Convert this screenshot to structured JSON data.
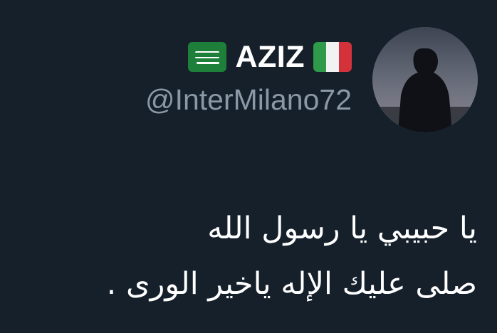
{
  "author": {
    "display_name": "AZIZ",
    "handle": "@InterMilano72",
    "flag_left": "saudi-arabia-flag-icon",
    "flag_right": "italy-flag-icon"
  },
  "tweet": {
    "lines": [
      "يا حبيبي يا رسول الله",
      "صلى عليك الإله ياخير الورى ."
    ]
  },
  "colors": {
    "background": "#15202b",
    "text_primary": "#ffffff",
    "text_secondary": "#8b98a5"
  }
}
